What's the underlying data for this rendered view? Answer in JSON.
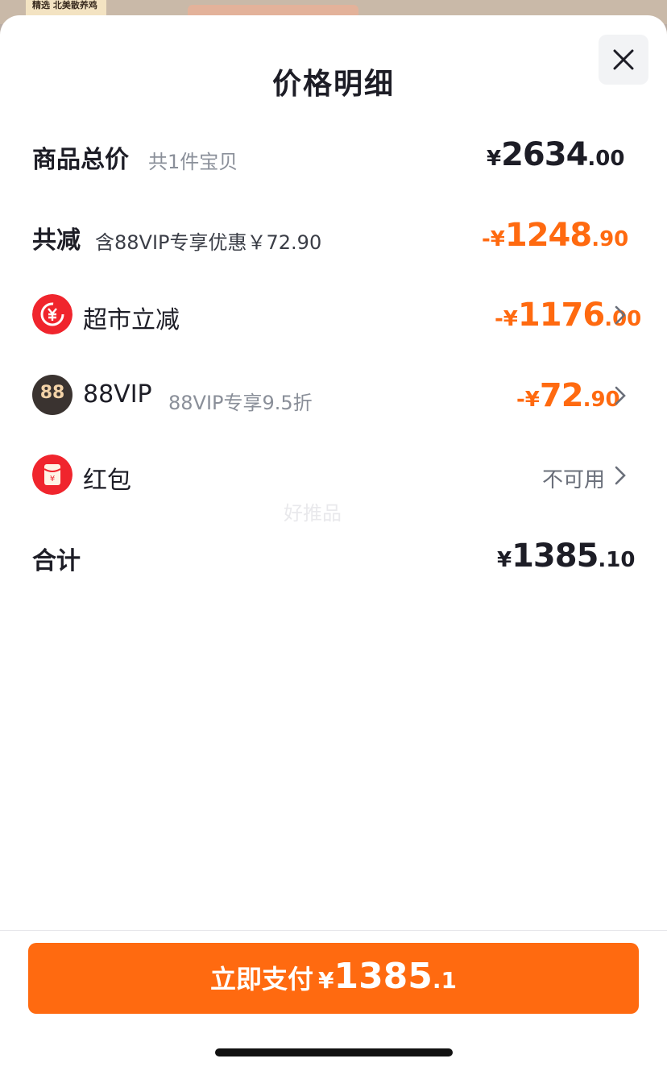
{
  "background": {
    "banner_text": "精选 北美散养鸡"
  },
  "sheet": {
    "title": "价格明细"
  },
  "rows": {
    "total_goods": {
      "label": "商品总价",
      "sub": "共1件宝贝",
      "currency": "¥",
      "int": "2634",
      "dec": ".00"
    },
    "total_discount": {
      "label": "共减",
      "sub": "含88VIP专享优惠￥72.90",
      "currency": "-¥",
      "int": "1248",
      "dec": ".90"
    },
    "supermarket": {
      "label": "超市立减",
      "icon": "coupon-yen-icon",
      "currency": "-¥",
      "int": "1176",
      "dec": ".00"
    },
    "vip": {
      "label": "88VIP",
      "icon": "88vip-badge-icon",
      "badge_text": "88",
      "sub": "88VIP专享9.5折",
      "currency": "-¥",
      "int": "72",
      "dec": ".90"
    },
    "red_packet": {
      "label": "红包",
      "icon": "red-packet-icon",
      "status": "不可用"
    },
    "sum": {
      "label": "合计",
      "currency": "¥",
      "int": "1385",
      "dec": ".10"
    }
  },
  "watermark": "好推品",
  "pay_button": {
    "label": "立即支付",
    "currency": "¥",
    "int": "1385",
    "dec": ".1"
  },
  "colors": {
    "accent": "#ff6a10",
    "text": "#1d1d26",
    "muted": "#8a8f99"
  }
}
